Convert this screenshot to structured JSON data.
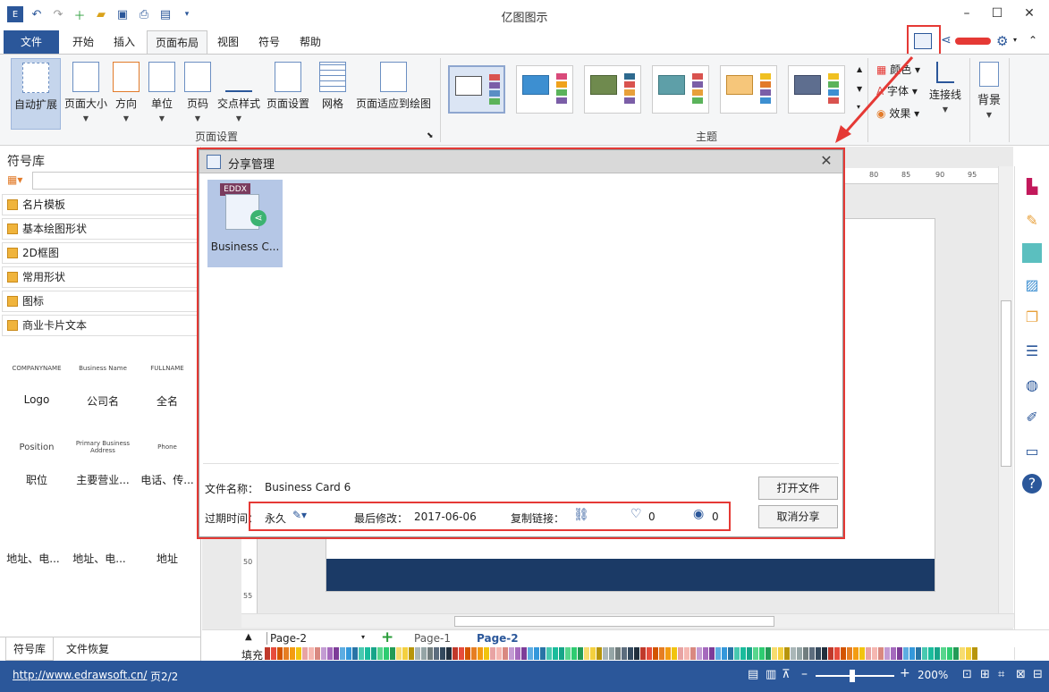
{
  "window": {
    "title": "亿图图示",
    "minimize": "–",
    "maximize": "☐",
    "close": "✕",
    "ribbon_toggle": "⌃",
    "help": "?"
  },
  "menu": {
    "tabs": [
      "文件",
      "开始",
      "插入",
      "页面布局",
      "视图",
      "符号",
      "帮助"
    ],
    "active": "页面布局"
  },
  "ribbon": {
    "page_setup_group": "页面设置",
    "buttons": [
      {
        "label": "自动扩展",
        "pressed": true
      },
      {
        "label": "页面大小"
      },
      {
        "label": "方向"
      },
      {
        "label": "单位"
      },
      {
        "label": "页码"
      },
      {
        "label": "交点样式"
      },
      {
        "label": "页面设置"
      },
      {
        "label": "网格"
      },
      {
        "label": "页面适应到绘图"
      }
    ],
    "theme_group": "主题",
    "theme_options": [
      "颜色",
      "字体",
      "效果"
    ],
    "connector": "连接线",
    "background": "背景"
  },
  "left_panel": {
    "title": "符号库",
    "categories": [
      "名片模板",
      "基本绘图形状",
      "2D框图",
      "常用形状",
      "图标",
      "商业卡片文本"
    ],
    "shapes": [
      {
        "name": "Logo",
        "thumb": "COMPANYNAME"
      },
      {
        "name": "公司名",
        "thumb": "Business Name"
      },
      {
        "name": "全名",
        "thumb": "FULLNAME"
      },
      {
        "name": "职位",
        "thumb": "Position"
      },
      {
        "name": "主要营业...",
        "thumb": "Primary Business Address"
      },
      {
        "name": "电话、传...",
        "thumb": "Phone"
      },
      {
        "name": "地址、电...",
        "thumb": ""
      },
      {
        "name": "地址、电...",
        "thumb": ""
      },
      {
        "name": "地址",
        "thumb": ""
      }
    ],
    "tabs": [
      "符号库",
      "文件恢复"
    ]
  },
  "ruler": {
    "top_marks": [
      "80",
      "85",
      "90",
      "95"
    ],
    "left_marks": [
      "50",
      "55"
    ]
  },
  "page_tabs": {
    "current": "Page-2",
    "add": "+",
    "pages": [
      "Page-1",
      "Page-2"
    ],
    "active": "Page-2"
  },
  "fill_label": "填充",
  "status": {
    "url": "http://www.edrawsoft.cn/",
    "page": "页2/2",
    "zoom": "200%"
  },
  "dialog": {
    "title": "分享管理",
    "close": "✕",
    "file_badge": "EDDX",
    "file_item": "Business C...",
    "filename_label": "文件名称：",
    "filename": "Business Card 6",
    "expire_label": "过期时间：",
    "expire_value": "永久",
    "modified_label": "最后修改：",
    "modified_value": "2017-06-06",
    "copy_link_label": "复制链接：",
    "likes": "0",
    "views": "0",
    "open_button": "打开文件",
    "cancel_button": "取消分享"
  },
  "colors": {
    "accent": "#2b579a",
    "annotation": "#e53935",
    "page_band": "#1b3a66"
  }
}
